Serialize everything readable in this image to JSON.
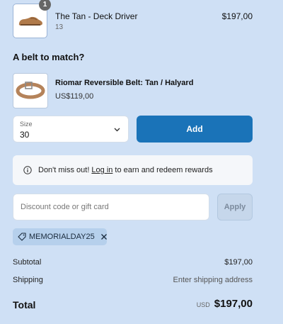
{
  "cart_item": {
    "quantity": "1",
    "name": "The Tan - Deck Driver",
    "variant": "13",
    "price": "$197,00",
    "image_icon": "loafer-shoe-icon"
  },
  "upsell": {
    "heading": "A belt to match?",
    "product_name": "Riomar Reversible Belt: Tan / Halyard",
    "product_price": "US$119,00",
    "image_icon": "belt-icon",
    "size_label": "Size",
    "size_value": "30",
    "add_label": "Add"
  },
  "notice": {
    "before": "Don't miss out!",
    "link": "Log in",
    "after": "to earn and redeem rewards"
  },
  "discount": {
    "placeholder": "Discount code or gift card",
    "apply_label": "Apply",
    "applied_code": "MEMORIALDAY25"
  },
  "summary": {
    "subtotal_label": "Subtotal",
    "subtotal_value": "$197,00",
    "shipping_label": "Shipping",
    "shipping_value": "Enter shipping address",
    "total_label": "Total",
    "currency": "USD",
    "total_value": "$197,00"
  },
  "colors": {
    "background": "#cfe0f5",
    "primary_button": "#1a73b8",
    "chip": "#b6d0ec"
  }
}
